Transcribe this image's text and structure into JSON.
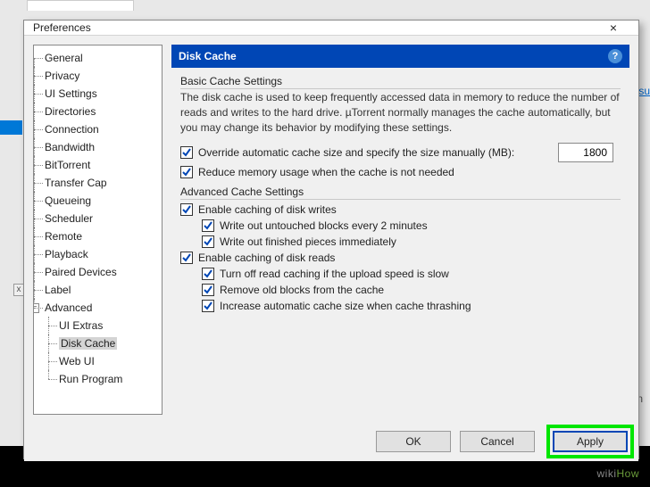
{
  "dialog": {
    "title": "Preferences",
    "close": "×"
  },
  "bg": {
    "link": "our su",
    "ration": "ration",
    "x": "x"
  },
  "tree": {
    "items": [
      "General",
      "Privacy",
      "UI Settings",
      "Directories",
      "Connection",
      "Bandwidth",
      "BitTorrent",
      "Transfer Cap",
      "Queueing",
      "Scheduler",
      "Remote",
      "Playback",
      "Paired Devices",
      "Label"
    ],
    "advanced": {
      "label": "Advanced",
      "exp": "−",
      "children": [
        "UI Extras",
        "Disk Cache",
        "Web UI",
        "Run Program"
      ]
    }
  },
  "pane": {
    "title": "Disk Cache",
    "help": "?",
    "basic": {
      "title": "Basic Cache Settings",
      "desc": "The disk cache is used to keep frequently accessed data in memory to reduce the number of reads and writes to the hard drive. µTorrent normally manages the cache automatically, but you may change its behavior by modifying these settings.",
      "override": "Override automatic cache size and specify the size manually (MB):",
      "size": "1800",
      "reduce": "Reduce memory usage when the cache is not needed"
    },
    "adv": {
      "title": "Advanced Cache Settings",
      "writes": "Enable caching of disk writes",
      "w1": "Write out untouched blocks every 2 minutes",
      "w2": "Write out finished pieces immediately",
      "reads": "Enable caching of disk reads",
      "r1": "Turn off read caching if the upload speed is slow",
      "r2": "Remove old blocks from the cache",
      "r3": "Increase automatic cache size when cache thrashing"
    }
  },
  "buttons": {
    "ok": "OK",
    "cancel": "Cancel",
    "apply": "Apply"
  },
  "watermark": {
    "a": "wiki",
    "b": "How"
  }
}
